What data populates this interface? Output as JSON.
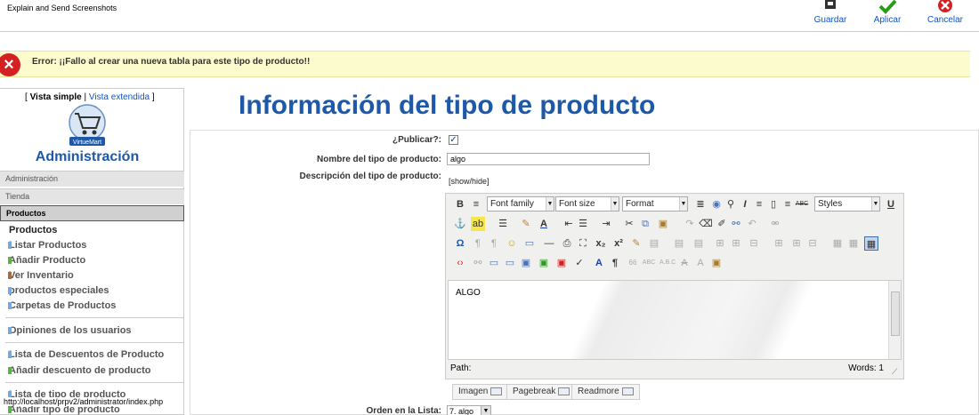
{
  "window": {
    "title": "Explain and Send Screenshots"
  },
  "toolbar": {
    "save_label": "Guardar",
    "apply_label": "Aplicar",
    "cancel_label": "Cancelar"
  },
  "error": {
    "message": "Error: ¡¡Fallo al crear una nueva tabla para este tipo de producto!!"
  },
  "sidebar": {
    "views_open": "[",
    "simple_view": "Vista simple",
    "pipe": "|",
    "extended_view": "Vista extendida",
    "views_close": "]",
    "logo_text": "VirtueMart",
    "title": "Administración",
    "sections": [
      "Administración",
      "Tienda",
      "Productos"
    ],
    "menu_head": "Productos",
    "items": [
      "Listar Productos",
      "Añadir Producto",
      "Ver Inventario",
      "productos especiales",
      "Carpetas de Productos",
      "Opiniones de los usuarios",
      "Lista de Descuentos de Producto",
      "Añadir descuento de producto",
      "Lista de tipo de producto",
      "Añadir tipo de producto"
    ]
  },
  "status_url": "http://localhost/prpv2/administrator/index.php",
  "main": {
    "title": "Información del tipo de producto",
    "publish_label": "¿Publicar?:",
    "publish_checked": true,
    "name_label": "Nombre del tipo de producto:",
    "name_value": "algo",
    "description_label": "Descripción del tipo de producto:",
    "show_hide": "[show/hide]",
    "order_label": "Orden en la Lista:",
    "order_value": "7. algo"
  },
  "editor": {
    "font_family": "Font family",
    "font_size": "Font size",
    "format": "Format",
    "styles": "Styles",
    "content": "ALGO",
    "path_label": "Path:",
    "words_label": "Words: 1",
    "buttons": [
      "Imagen",
      "Pagebreak",
      "Readmore"
    ]
  },
  "colors": {
    "accent": "#1d59a8",
    "link": "#0b55c4",
    "error_bg": "#fbfbcd",
    "error_icon": "#d32020"
  }
}
